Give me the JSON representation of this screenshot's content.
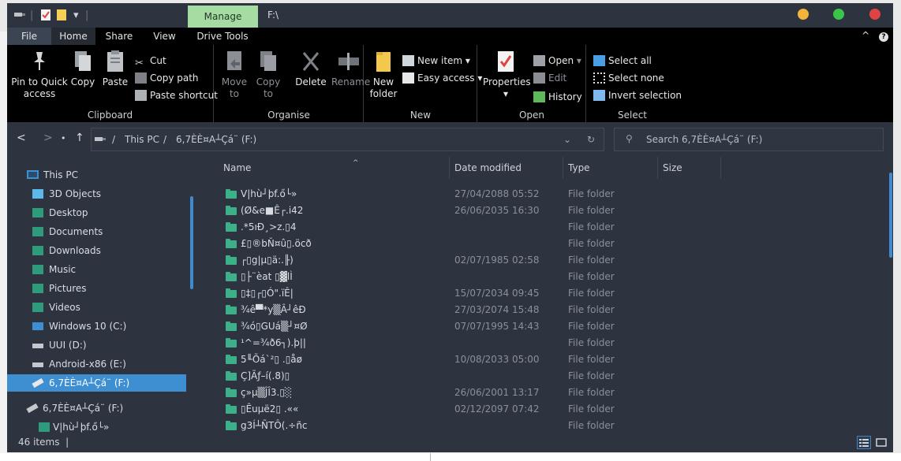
{
  "titlebar": {
    "manage_label": "Manage",
    "path": "F:\\",
    "colors": {
      "close": "#e04343",
      "max": "#39c548",
      "min": "#f4b43a"
    }
  },
  "tabs": [
    {
      "label": "File"
    },
    {
      "label": "Home"
    },
    {
      "label": "Share"
    },
    {
      "label": "View"
    },
    {
      "label": "Drive Tools"
    }
  ],
  "ribbon": {
    "clipboard": {
      "label": "Clipboard",
      "pin": "Pin to Quick access",
      "copy": "Copy",
      "paste": "Paste",
      "cut": "Cut",
      "copy_path": "Copy path",
      "paste_shortcut": "Paste shortcut"
    },
    "organise": {
      "label": "Organise",
      "move_to": "Move to",
      "copy_to": "Copy to",
      "delete": "Delete",
      "rename": "Rename"
    },
    "new": {
      "label": "New",
      "new_folder": "New folder",
      "new_item": "New item",
      "easy_access": "Easy access"
    },
    "open": {
      "label": "Open",
      "properties": "Properties",
      "open": "Open",
      "edit": "Edit",
      "history": "History"
    },
    "select": {
      "label": "Select",
      "select_all": "Select all",
      "select_none": "Select none",
      "invert": "Invert selection"
    }
  },
  "address": {
    "this_pc": "This PC",
    "drive": "6,7ÈÈ¤A┴Çá¨ (F:)",
    "search_placeholder": "Search 6,7ÈÈ¤A┴Çá¨ (F:)"
  },
  "nav": {
    "items": [
      {
        "label": "This PC",
        "icon": "monitor-icon"
      },
      {
        "label": "3D Objects",
        "icon": "cube-icon"
      },
      {
        "label": "Desktop",
        "icon": "folder-icon"
      },
      {
        "label": "Documents",
        "icon": "folder-icon"
      },
      {
        "label": "Downloads",
        "icon": "folder-icon"
      },
      {
        "label": "Music",
        "icon": "folder-icon"
      },
      {
        "label": "Pictures",
        "icon": "folder-icon"
      },
      {
        "label": "Videos",
        "icon": "folder-icon"
      },
      {
        "label": "Windows 10 (C:)",
        "icon": "windows-drive-icon"
      },
      {
        "label": "UUI (D:)",
        "icon": "drive-icon"
      },
      {
        "label": "Android-x86 (E:)",
        "icon": "drive-icon"
      },
      {
        "label": "6,7ÈÈ¤A┴Çá¨ (F:)",
        "icon": "usb-drive-icon"
      },
      {
        "label": "6,7ÈÈ¤A┴Çá¨ (F:)",
        "icon": "usb-drive-icon"
      },
      {
        "label": "V|hù┘þf.ő└»",
        "icon": "folder-icon"
      }
    ]
  },
  "columns": {
    "name": "Name",
    "date": "Date modified",
    "type": "Type",
    "size": "Size"
  },
  "files": [
    {
      "name": "V|hù┘þf.ő└»",
      "date": "27/04/2088 05:52",
      "type": "File folder"
    },
    {
      "name": "(Ø&e■Ê┌.i42",
      "date": "26/06/2035 16:30",
      "type": "File folder"
    },
    {
      "name": ".*5ıÐ¸>z.▯4",
      "date": "",
      "type": "File folder"
    },
    {
      "name": "£▯®bŇ¤û▯.öcð",
      "date": "",
      "type": "File folder"
    },
    {
      "name": "┌▯g|µ▯ä:.╟)",
      "date": "02/07/1985 02:58",
      "type": "File folder"
    },
    {
      "name": "▯├¨èat ▯▓lÌ",
      "date": "",
      "type": "File folder"
    },
    {
      "name": "▯‡▯┌▯Ó\".ïÊ|",
      "date": "15/07/2034 09:45",
      "type": "File folder"
    },
    {
      "name": "¾ê▀*y▒Â┘êÐ",
      "date": "27/03/2074 15:48",
      "type": "File folder"
    },
    {
      "name": "¾ó▯GUá▒┘¤Ø",
      "date": "07/07/1995 14:43",
      "type": "File folder"
    },
    {
      "name": "¹^=¾ð6┐).þ||",
      "date": "",
      "type": "File folder"
    },
    {
      "name": "5╙Õá`²▯ .▯åø",
      "date": "10/08/2033 05:00",
      "type": "File folder"
    },
    {
      "name": "Ç]Ãƒ–í(.8)▯",
      "date": "",
      "type": "File folder"
    },
    {
      "name": "ç»µ▒ĴÎ3.▯░",
      "date": "26/06/2001 13:17",
      "type": "File folder"
    },
    {
      "name": "▯Êuµë2▯ .««",
      "date": "02/12/2097 07:42",
      "type": "File folder"
    },
    {
      "name": "g3Í┴ÑTÔ(.÷ñc",
      "date": "",
      "type": "File folder"
    }
  ],
  "status": {
    "count": "46 items"
  }
}
